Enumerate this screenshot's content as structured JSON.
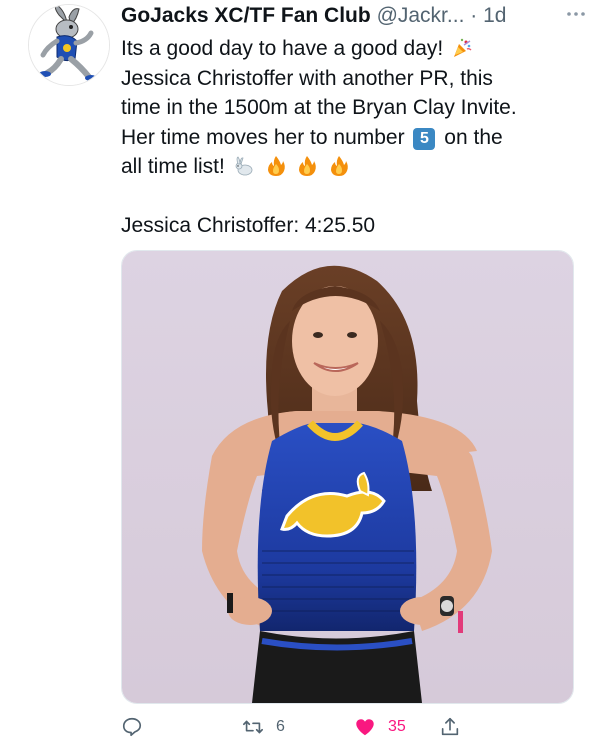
{
  "tweet": {
    "display_name": "GoJacks XC/TF Fan Club",
    "handle": "@Jackr...",
    "separator": "·",
    "time": "1d",
    "text_lines": [
      "Its a good day to have a good day!",
      "Jessica Christoffer with another PR, this",
      "time in the 1500m at the Bryan Clay Invite.",
      "Her time moves her to number",
      "on the",
      "all time list!",
      "Jessica Christoffer: 4:25.50"
    ],
    "keycap_number": "5"
  },
  "actions": {
    "reply_count": "",
    "retweet_count": "6",
    "like_count": "35",
    "share_count": ""
  },
  "icons": {
    "avatar": "jackrabbit-mascot",
    "more": "more-horizontal-icon",
    "party": "party-popper-emoji",
    "rabbit": "rabbit-emoji",
    "fire": "fire-emoji",
    "reply": "reply-icon",
    "retweet": "retweet-icon",
    "like": "heart-icon",
    "share": "share-icon"
  },
  "colors": {
    "text": "#0f1419",
    "secondary": "#536471",
    "like": "#f91880",
    "keycap": "#3b88c3"
  }
}
